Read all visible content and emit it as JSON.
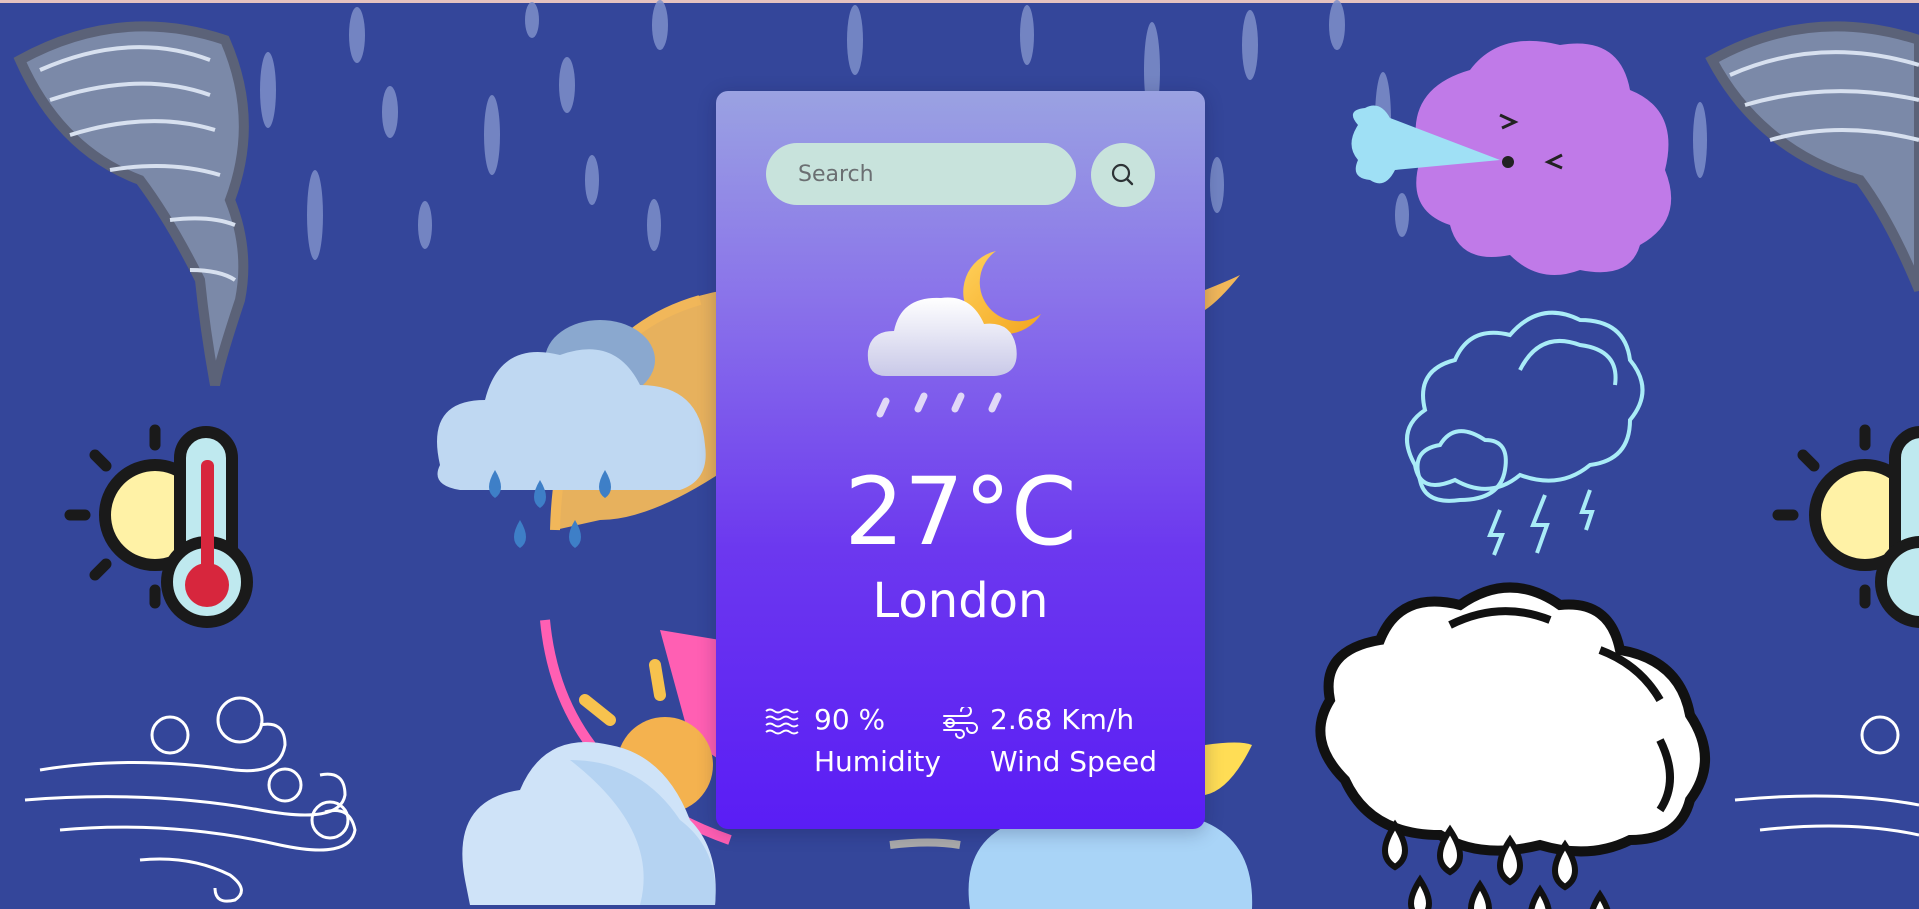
{
  "search": {
    "placeholder": "Search"
  },
  "weather": {
    "temperature": "27°C",
    "city": "London",
    "condition_icon": "cloud-moon-rain-icon"
  },
  "details": {
    "humidity": {
      "value": "90 %",
      "label": "Humidity",
      "icon": "humidity-icon"
    },
    "wind": {
      "value": "2.68 Km/h",
      "label": "Wind Speed",
      "icon": "wind-icon"
    }
  },
  "colors": {
    "page_background": "#34469a",
    "card_top": "#9aa2e2",
    "card_bottom": "#5a1df5",
    "search_field": "#c8e3dc"
  }
}
